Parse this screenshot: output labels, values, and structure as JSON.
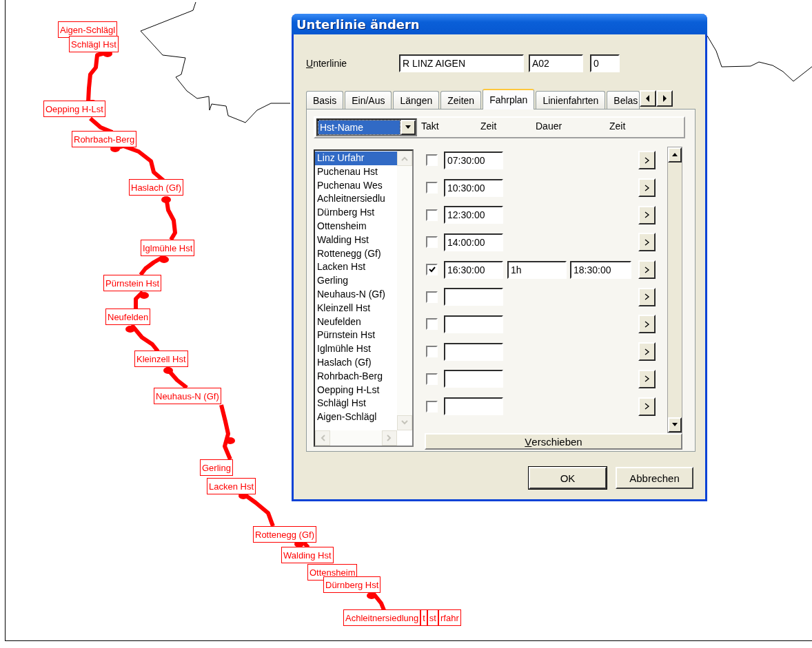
{
  "map": {
    "stop_labels": [
      {
        "text": "Aigen-Schlägl"
      },
      {
        "text": "Schlägl Hst"
      },
      {
        "text": "Oepping H-Lst"
      },
      {
        "text": "Rohrbach-Berg"
      },
      {
        "text": "Haslach (Gf)"
      },
      {
        "text": "Iglmühle Hst"
      },
      {
        "text": "Pürnstein Hst"
      },
      {
        "text": "Neufelden"
      },
      {
        "text": "Kleinzell Hst"
      },
      {
        "text": "Neuhaus-N (Gf)"
      },
      {
        "text": "Gerling"
      },
      {
        "text": "Lacken Hst"
      },
      {
        "text": "Rottenegg (Gf)"
      },
      {
        "text": "Walding Hst"
      },
      {
        "text": "Ottensheim"
      },
      {
        "text": "Dürnberg Hst"
      },
      {
        "text": "Achleitnersiedlung"
      },
      {
        "text": "t"
      },
      {
        "text": "st"
      },
      {
        "text": "rfahr"
      }
    ]
  },
  "dialog": {
    "title": "Unterlinie ändern",
    "unterlinie": {
      "label": "Unterlinie",
      "name": "R LINZ AIGEN",
      "code": "A02",
      "number": "0"
    },
    "tabs": [
      {
        "label": "Basis",
        "selected": false
      },
      {
        "label": "Ein/Aus",
        "selected": false
      },
      {
        "label": "Längen",
        "selected": false
      },
      {
        "label": "Zeiten",
        "selected": false
      },
      {
        "label": "Fahrplan",
        "selected": true
      },
      {
        "label": "Linienfahrten",
        "selected": false
      },
      {
        "label": "Belas",
        "selected": false
      }
    ],
    "header": {
      "dropdown": "Hst-Name",
      "columns": [
        "Takt",
        "Zeit",
        "Dauer",
        "Zeit"
      ]
    },
    "stops": [
      {
        "name": "Linz Urfahr",
        "selected": true
      },
      {
        "name": "Puchenau Hst",
        "selected": false
      },
      {
        "name": "Puchenau Wes",
        "selected": false
      },
      {
        "name": "Achleitnersiedlu",
        "selected": false
      },
      {
        "name": "Dürnberg Hst",
        "selected": false
      },
      {
        "name": "Ottensheim",
        "selected": false
      },
      {
        "name": "Walding Hst",
        "selected": false
      },
      {
        "name": "Rottenegg (Gf)",
        "selected": false
      },
      {
        "name": "Lacken Hst",
        "selected": false
      },
      {
        "name": "Gerling",
        "selected": false
      },
      {
        "name": "Neuhaus-N (Gf)",
        "selected": false
      },
      {
        "name": "Kleinzell Hst",
        "selected": false
      },
      {
        "name": "Neufelden",
        "selected": false
      },
      {
        "name": "Pürnstein Hst",
        "selected": false
      },
      {
        "name": "Iglmühle Hst",
        "selected": false
      },
      {
        "name": "Haslach (Gf)",
        "selected": false
      },
      {
        "name": "Rohrbach-Berg",
        "selected": false
      },
      {
        "name": "Oepping H-Lst",
        "selected": false
      },
      {
        "name": "Schlägl Hst",
        "selected": false
      },
      {
        "name": "Aigen-Schlägl",
        "selected": false
      }
    ],
    "schedule": [
      {
        "checked": false,
        "zeit": "07:30:00"
      },
      {
        "checked": false,
        "zeit": "10:30:00"
      },
      {
        "checked": false,
        "zeit": "12:30:00"
      },
      {
        "checked": false,
        "zeit": "14:00:00"
      },
      {
        "checked": true,
        "zeit": "16:30:00",
        "dauer": "1h",
        "zeit_end": "18:30:00"
      },
      {
        "checked": false
      },
      {
        "checked": false
      },
      {
        "checked": false
      },
      {
        "checked": false
      },
      {
        "checked": false
      }
    ],
    "shift_button": "Verschieben",
    "buttons": [
      "OK",
      "Abbrechen"
    ]
  }
}
